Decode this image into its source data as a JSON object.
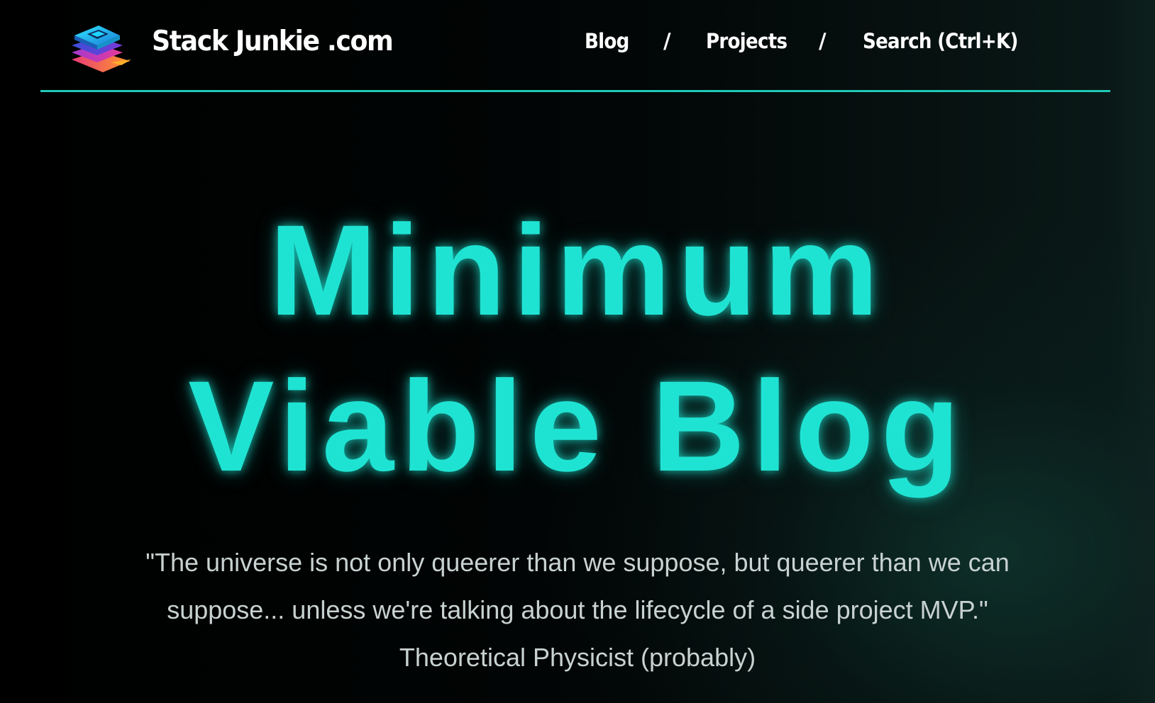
{
  "header": {
    "site_name": "Stack Junkie .com",
    "logo_icon": "stacked-layers-icon",
    "accent_color": "#1fc8b6"
  },
  "nav": {
    "items": [
      {
        "label": "Blog"
      },
      {
        "label": "Projects"
      },
      {
        "label": "Search (Ctrl+K)"
      }
    ],
    "separator": "/"
  },
  "hero": {
    "title_line1": "Minimum",
    "title_line2": "Viable Blog",
    "title_color": "#1fe3d2",
    "quote": "\"The universe is not only queerer than we suppose, but queerer than we can suppose... unless we're talking about the lifecycle of a side project MVP.\" Theoretical Physicist (probably)"
  }
}
